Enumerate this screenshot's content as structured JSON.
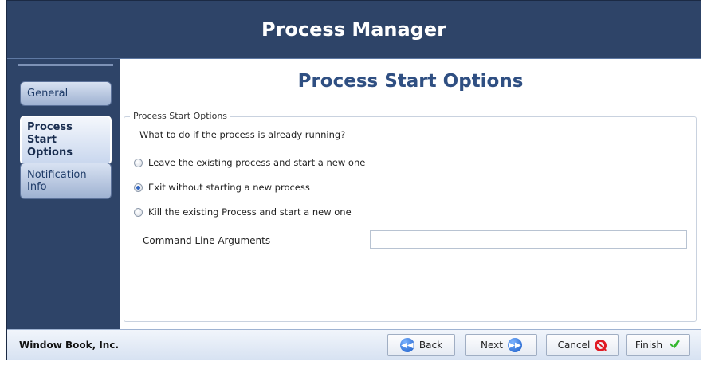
{
  "window": {
    "title": "Process Manager"
  },
  "sidebar": {
    "items": [
      {
        "label": "General"
      },
      {
        "label": "Process Start\nOptions",
        "active": true
      },
      {
        "label": "Notification Info"
      }
    ]
  },
  "content": {
    "title": "Process Start Options",
    "group_legend": "Process Start Options",
    "question": "What to do if the process is already running?",
    "options": [
      {
        "label": "Leave the existing process and start a new one",
        "selected": false
      },
      {
        "label": "Exit without starting a new process",
        "selected": true
      },
      {
        "label": "Kill the existing Process and start a new one",
        "selected": false
      }
    ],
    "command_line": {
      "label": "Command Line Arguments",
      "value": ""
    }
  },
  "footer": {
    "company": "Window Book, Inc.",
    "buttons": {
      "back": "Back",
      "next": "Next",
      "cancel": "Cancel",
      "finish": "Finish"
    }
  },
  "colors": {
    "frame": "#2e4468",
    "accent": "#2f4f82",
    "cancel": "#e01b24",
    "finish": "#35b82f"
  }
}
